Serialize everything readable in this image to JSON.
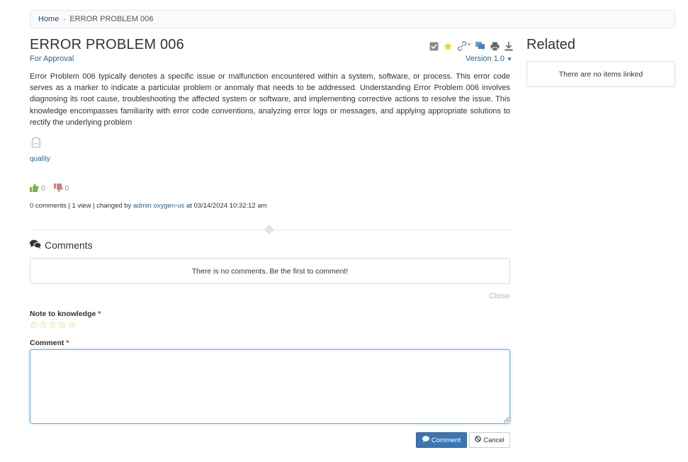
{
  "breadcrumb": {
    "home": "Home",
    "separator": "›",
    "current": "ERROR PROBLEM 006"
  },
  "article": {
    "title": "ERROR PROBLEM 006",
    "status": "For Approval",
    "version": "Version 1.0",
    "description": "Error Problem 006 typically denotes a specific issue or malfunction encountered within a system, software, or process. This error code serves as a marker to indicate a particular problem or anomaly that needs to be addressed. Understanding Error Problem 006 involves diagnosing its root cause, troubleshooting the affected system or software, and implementing corrective actions to resolve the issue. This knowledge encompasses familiarity with error code conventions, analyzing error logs or messages, and applying appropriate solutions to rectify the underlying problem",
    "tag": "quality",
    "likes": "0",
    "dislikes": "0",
    "meta": {
      "comments": "0 comments",
      "views": "1 view",
      "changed_by_prefix": "changed by",
      "author": "admin oxygen-us",
      "at_text": "at 03/14/2024 10:32:12 am"
    },
    "toolbar_icons": [
      "checkbox-icon",
      "star-icon",
      "link-icon",
      "comments-icon",
      "print-icon",
      "download-icon"
    ]
  },
  "comments": {
    "header": "Comments",
    "empty_message": "There is no comments. Be the first to comment!",
    "close_label": "Close",
    "note_label": "Note to knowledge",
    "comment_label": "Comment",
    "required_mark": "*",
    "comment_value": "",
    "submit_label": "Comment",
    "cancel_label": "Cancel",
    "rating_stars": 5
  },
  "related": {
    "title": "Related",
    "empty_message": "There are no items linked"
  },
  "colors": {
    "link": "#2a6496",
    "primary_button": "#3a76b3",
    "star": "#e8c93a",
    "like": "#7cb342",
    "dislike": "#c98080",
    "required": "#c9302c",
    "focus": "#66afe9"
  }
}
